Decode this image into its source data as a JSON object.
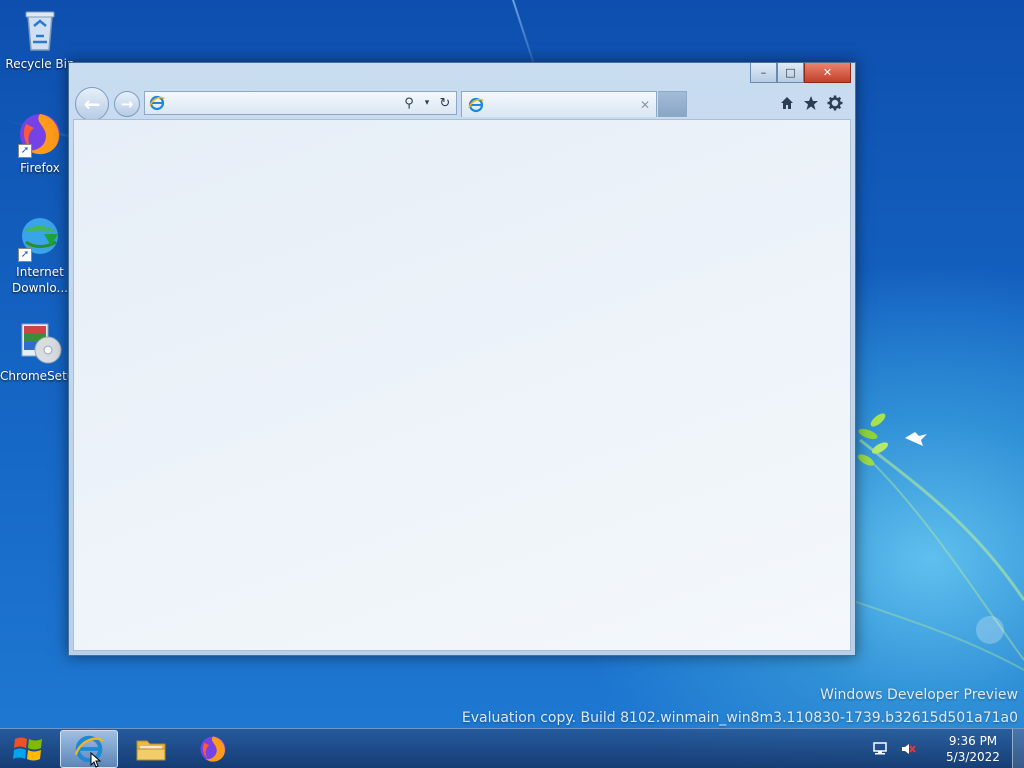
{
  "desktop": {
    "icons": [
      {
        "label": "Recycle Bin",
        "icon": "recycle-bin-icon"
      },
      {
        "label": "Firefox",
        "icon": "firefox-icon"
      },
      {
        "label": "Internet Downlo...",
        "icon": "internet-download-manager-icon"
      },
      {
        "label": "ChromeSetup",
        "icon": "chrome-setup-icon"
      }
    ]
  },
  "browser": {
    "address": {
      "value": "",
      "placeholder": ""
    },
    "tab": {
      "title": ""
    },
    "controls": {
      "minimize": "–",
      "maximize": "□",
      "close": "✕"
    }
  },
  "watermark": {
    "line1": "Windows Developer Preview",
    "line2": "Evaluation copy. Build 8102.winmain_win8m3.110830-1739.b32615d501a71a0"
  },
  "taskbar": {
    "items": [
      {
        "name": "internet-explorer",
        "active": true
      },
      {
        "name": "file-explorer",
        "active": false
      },
      {
        "name": "firefox",
        "active": false
      }
    ],
    "clock": {
      "time": "9:36 PM",
      "date": "5/3/2022"
    }
  },
  "colors": {
    "desktop_blue": "#1463c2",
    "window_frame": "#b8d0ea",
    "close_red": "#c2402a"
  }
}
